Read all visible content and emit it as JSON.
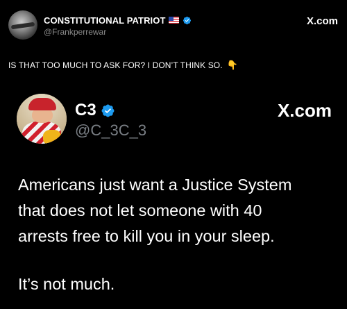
{
  "outer_post": {
    "author_name": "CONSTITUTIONAL PATRIOT",
    "author_flag": "us-flag-icon",
    "verified": true,
    "handle": "@Frankperrewar",
    "brand": "X.com",
    "text": "IS THAT TOO MUCH TO ASK FOR? I DON’T THINK SO.",
    "emoji": "👇"
  },
  "quoted_post": {
    "author_name": "C3",
    "verified": true,
    "handle": "@C_3C_3",
    "brand": "X.com",
    "body_lines": [
      "Americans just want a Justice System",
      "that does not let someone with 40",
      "arrests free to kill you in your sleep."
    ],
    "closing_line": "It’s not much."
  },
  "colors": {
    "background": "#000000",
    "text": "#ffffff",
    "handle": "#7a7f85",
    "verified_blue": "#1d9bf0"
  }
}
